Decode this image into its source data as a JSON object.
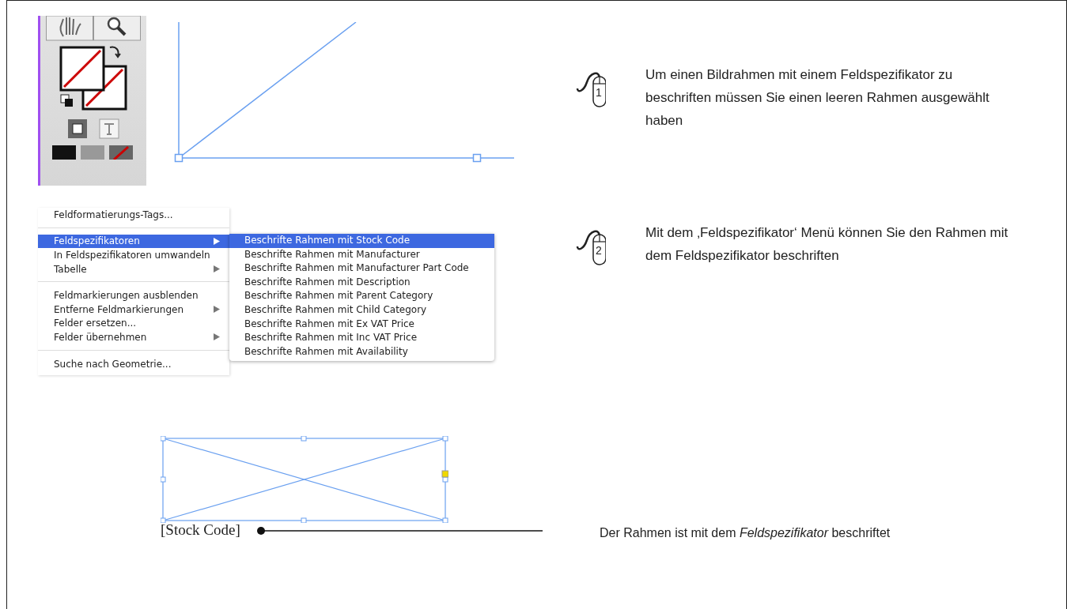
{
  "steps": [
    {
      "number": "1",
      "text": "Um einen Bildrahmen mit einem Feldspezifikator zu beschriften müssen Sie einen leeren Rahmen ausgewählt haben"
    },
    {
      "number": "2",
      "text": "Mit dem ‚Feldspezifikator‘ Menü können Sie den Rahmen mit dem Feldspezifikator beschriften"
    }
  ],
  "menu": {
    "items": [
      {
        "kind": "item",
        "label": "Feldformatierungs-Tags...",
        "submenu": false,
        "selected": false
      },
      {
        "kind": "separator"
      },
      {
        "kind": "item",
        "label": "Feldspezifikatoren",
        "submenu": true,
        "selected": true
      },
      {
        "kind": "item",
        "label": "In Feldspezifikatoren umwandeln",
        "submenu": false,
        "selected": false
      },
      {
        "kind": "item",
        "label": "Tabelle",
        "submenu": true,
        "selected": false
      },
      {
        "kind": "separator"
      },
      {
        "kind": "item",
        "label": "Feldmarkierungen ausblenden",
        "submenu": false,
        "selected": false
      },
      {
        "kind": "item",
        "label": "Entferne Feldmarkierungen",
        "submenu": true,
        "selected": false
      },
      {
        "kind": "item",
        "label": "Felder ersetzen...",
        "submenu": false,
        "selected": false
      },
      {
        "kind": "item",
        "label": "Felder übernehmen",
        "submenu": true,
        "selected": false
      },
      {
        "kind": "separator"
      },
      {
        "kind": "item",
        "label": "Suche nach Geometrie...",
        "submenu": false,
        "selected": false
      }
    ]
  },
  "submenu": {
    "items": [
      {
        "label": "Beschrifte Rahmen mit Stock Code",
        "selected": true
      },
      {
        "label": "Beschrifte Rahmen mit Manufacturer",
        "selected": false
      },
      {
        "label": "Beschrifte Rahmen mit Manufacturer Part Code",
        "selected": false
      },
      {
        "label": "Beschrifte Rahmen mit Description",
        "selected": false
      },
      {
        "label": "Beschrifte Rahmen mit Parent Category",
        "selected": false
      },
      {
        "label": "Beschrifte Rahmen mit Child Category",
        "selected": false
      },
      {
        "label": "Beschrifte Rahmen mit Ex VAT Price",
        "selected": false
      },
      {
        "label": "Beschrifte Rahmen mit Inc VAT Price",
        "selected": false
      },
      {
        "label": "Beschrifte Rahmen mit Availability",
        "selected": false
      }
    ]
  },
  "frame": {
    "label": "[Stock Code]"
  },
  "caption": "Der Rahmen ist mit dem *Feldspezifikator* beschriftet"
}
